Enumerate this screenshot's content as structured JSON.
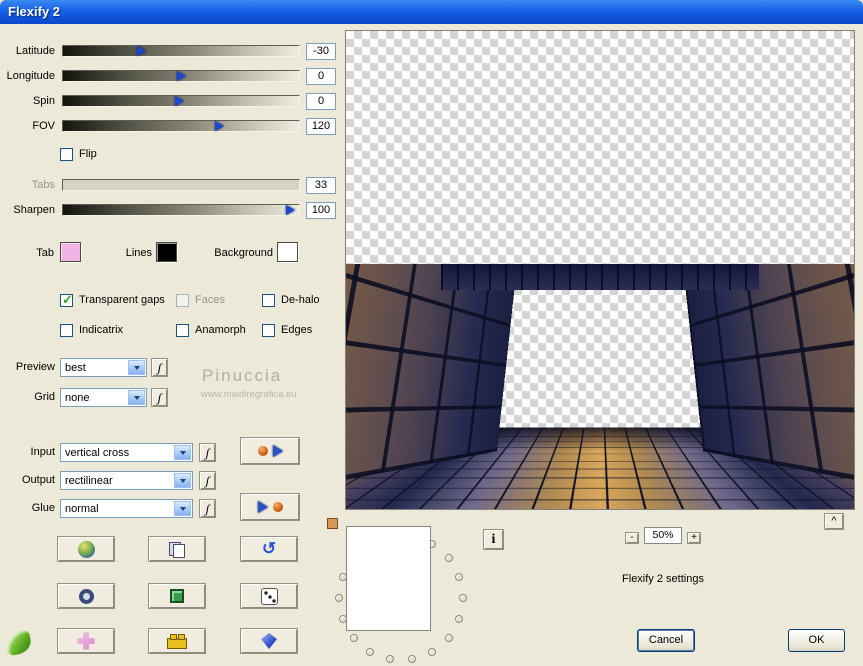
{
  "titlebar": {
    "title": "Flexify 2"
  },
  "colors": {
    "titlebar_blue": "#1660e8",
    "body": "#ece9d8",
    "tab_swatch": "#f2b4e6",
    "lines_swatch": "#000000",
    "background_swatch": "#ffffff",
    "check_green": "#2aa52a"
  },
  "sliders": {
    "latitude": {
      "label": "Latitude",
      "value": "-30"
    },
    "longitude": {
      "label": "Longitude",
      "value": "0"
    },
    "spin": {
      "label": "Spin",
      "value": "0"
    },
    "fov": {
      "label": "FOV",
      "value": "120"
    },
    "tabs": {
      "label": "Tabs",
      "value": "33"
    },
    "sharpen": {
      "label": "Sharpen",
      "value": "100"
    }
  },
  "checkboxes": {
    "flip": {
      "label": "Flip",
      "checked": false
    },
    "transparent_gaps": {
      "label": "Transparent gaps",
      "checked": true
    },
    "faces": {
      "label": "Faces",
      "checked": false
    },
    "dehalo": {
      "label": "De-halo",
      "checked": false
    },
    "indicatrix": {
      "label": "Indicatrix",
      "checked": false
    },
    "anamorph": {
      "label": "Anamorph",
      "checked": false
    },
    "edges": {
      "label": "Edges",
      "checked": false
    }
  },
  "swatches": {
    "tab": {
      "label": "Tab"
    },
    "lines": {
      "label": "Lines"
    },
    "background": {
      "label": "Background"
    }
  },
  "dropdowns": {
    "preview": {
      "label": "Preview",
      "value": "best"
    },
    "grid": {
      "label": "Grid",
      "value": "none"
    },
    "input": {
      "label": "Input",
      "value": "vertical cross"
    },
    "output": {
      "label": "Output",
      "value": "rectilinear"
    },
    "glue": {
      "label": "Glue",
      "value": "normal"
    }
  },
  "watermark": {
    "name": "Pinuccia",
    "url": "www.maidiregrafica.eu"
  },
  "icons": {
    "s": "ʃ",
    "check": "✓",
    "undo": "↺",
    "info": "i",
    "caret": "^"
  },
  "zoom": {
    "minus": "-",
    "level": "50%",
    "plus": "+"
  },
  "settings_label": "Flexify 2 settings",
  "buttons": {
    "cancel": "Cancel",
    "ok": "OK"
  }
}
